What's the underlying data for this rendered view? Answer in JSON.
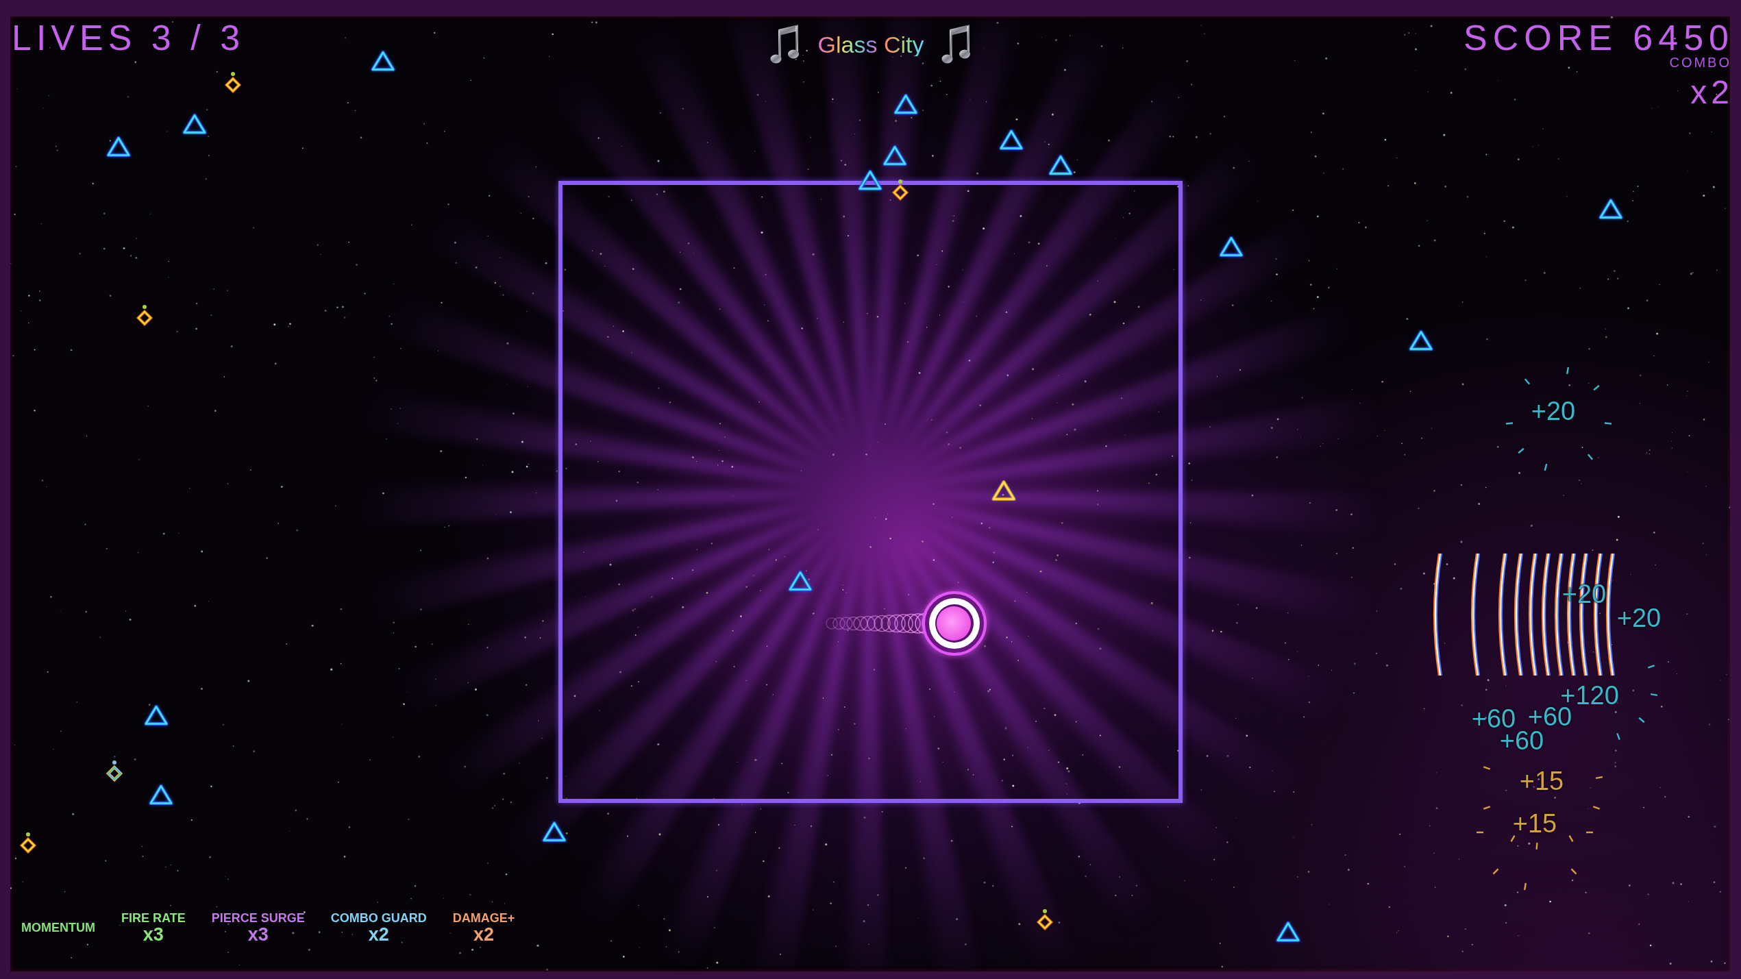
{
  "hud": {
    "lives": "LIVES 3 / 3",
    "track_title": "Glass City",
    "score": "SCORE 6450",
    "combo_label": "COMBO",
    "combo_value": "x2"
  },
  "powerups": [
    {
      "name": "MOMENTUM",
      "color": "#8ae07c"
    },
    {
      "name": "FIRE RATE",
      "count": "x3",
      "color": "#8ee57e"
    },
    {
      "name": "PIERCE SURGE",
      "count": "x3",
      "color": "#c27ae6"
    },
    {
      "name": "COMBO GUARD",
      "count": "x2",
      "color": "#84d2f2"
    },
    {
      "name": "DAMAGE+",
      "count": "x2",
      "color": "#f2a06c"
    }
  ],
  "score_popups": [
    {
      "text": "+20",
      "color": "#38b8c8"
    },
    {
      "text": "+20",
      "color": "#38b8c8"
    },
    {
      "text": "+20",
      "color": "#38b8c8"
    },
    {
      "text": "+120",
      "color": "#38b8c8"
    },
    {
      "text": "+60",
      "color": "#38b8c8"
    },
    {
      "text": "+60",
      "color": "#38b8c8"
    },
    {
      "text": "+60",
      "color": "#38b8c8"
    },
    {
      "text": "+15",
      "color": "#d6a23c"
    },
    {
      "text": "+15",
      "color": "#d6a23c"
    }
  ]
}
